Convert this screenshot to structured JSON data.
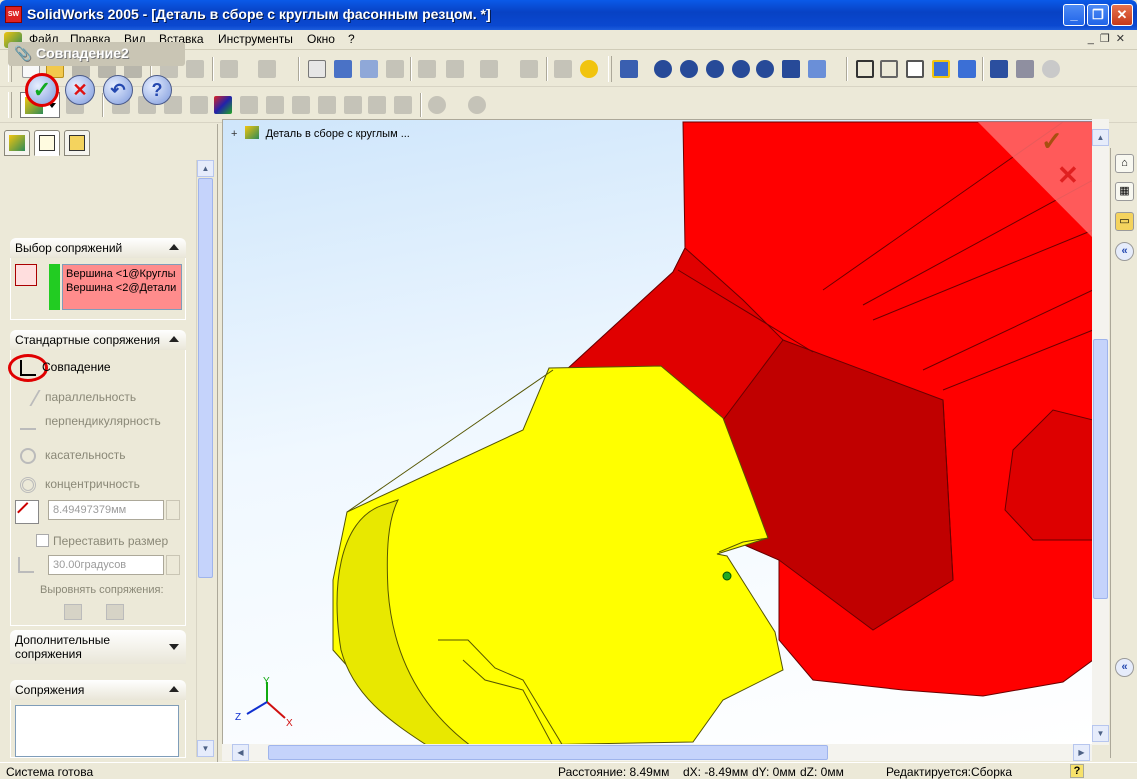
{
  "window": {
    "title": "SolidWorks 2005 - [Деталь в сборе с круглым фасонным резцом. *]",
    "app_icon": "SW"
  },
  "menu": {
    "items": [
      "Файл",
      "Правка",
      "Вид",
      "Вставка",
      "Инструменты",
      "Окно",
      "?"
    ]
  },
  "property_manager": {
    "title": "Совпадение2",
    "buttons": {
      "ok": "✓",
      "cancel": "✕",
      "undo": "↶",
      "help": "?"
    },
    "selection_group": {
      "header": "Выбор сопряжений",
      "items": [
        "Вершина <1@Круглы",
        "Вершина <2@Детали"
      ]
    },
    "standard_group": {
      "header": "Стандартные сопряжения",
      "mates": [
        "Совпадение",
        "параллельность",
        "перпендикулярность",
        "касательность",
        "концентричность"
      ],
      "distance_value": "8.49497379мм",
      "flip_label": "Переставить размер",
      "angle_value": "30.00градусов",
      "align_label": "Выровнять сопряжения:"
    },
    "advanced_group": {
      "header": "Дополнительные сопряжения"
    },
    "mates_group": {
      "header": "Сопряжения"
    }
  },
  "viewport": {
    "tree_label": "Деталь в сборе с круглым ...",
    "triad": {
      "x": "X",
      "y": "Y",
      "z": "Z"
    }
  },
  "statusbar": {
    "status": "Система готова",
    "distance": "Расстояние: 8.49мм",
    "dx": "dX: -8.49мм",
    "dy": "dY: 0мм",
    "dz": "dZ: 0мм",
    "editing": "Редактируется:Сборка",
    "help": "?"
  },
  "colors": {
    "red_part": "#ff0000",
    "yellow_part": "#ffff00",
    "selection_green": "#22cc22",
    "selection_pink": "#ff8c8c",
    "title_blue": "#0a48d0"
  }
}
